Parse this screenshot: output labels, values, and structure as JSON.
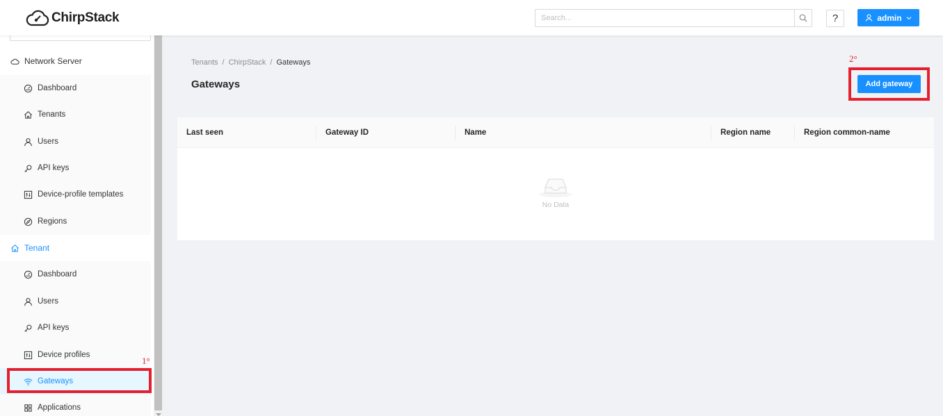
{
  "app": {
    "logo_text": "ChirpStack"
  },
  "header": {
    "search_placeholder": "Search...",
    "help_label": "?",
    "user_label": "admin"
  },
  "sidebar": {
    "network_server": {
      "label": "Network Server",
      "items": [
        {
          "label": "Dashboard",
          "icon": "dashboard-icon"
        },
        {
          "label": "Tenants",
          "icon": "home-icon"
        },
        {
          "label": "Users",
          "icon": "user-icon"
        },
        {
          "label": "API keys",
          "icon": "key-icon"
        },
        {
          "label": "Device-profile templates",
          "icon": "control-icon"
        },
        {
          "label": "Regions",
          "icon": "compass-icon"
        }
      ]
    },
    "tenant": {
      "label": "Tenant",
      "items": [
        {
          "label": "Dashboard",
          "icon": "dashboard-icon"
        },
        {
          "label": "Users",
          "icon": "user-icon"
        },
        {
          "label": "API keys",
          "icon": "key-icon"
        },
        {
          "label": "Device profiles",
          "icon": "control-icon"
        },
        {
          "label": "Gateways",
          "icon": "wifi-icon",
          "selected": true
        },
        {
          "label": "Applications",
          "icon": "appstore-icon"
        }
      ]
    }
  },
  "breadcrumb": [
    "Tenants",
    "ChirpStack",
    "Gateways"
  ],
  "page": {
    "title": "Gateways",
    "add_button": "Add gateway"
  },
  "table": {
    "columns": [
      "Last seen",
      "Gateway ID",
      "Name",
      "Region name",
      "Region common-name"
    ],
    "empty_text": "No Data"
  },
  "annotations": {
    "first": "1°",
    "second": "2°",
    "color": "#e5202e"
  },
  "colors": {
    "primary": "#1890ff",
    "selected_bg": "#e6f7ff",
    "background": "#f0f2f5"
  }
}
